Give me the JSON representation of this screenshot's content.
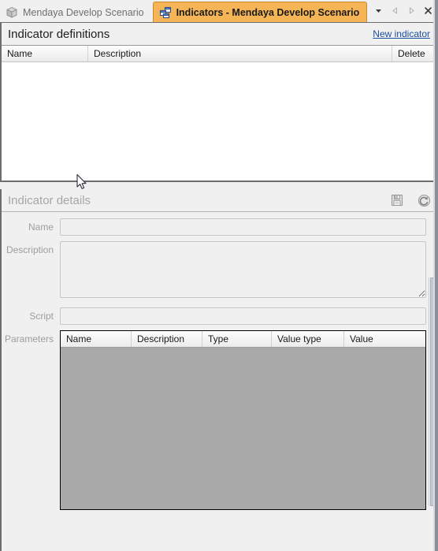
{
  "window": {
    "tabs": [
      {
        "label": "Mendaya Develop Scenario",
        "icon": "cube-icon",
        "active": false
      },
      {
        "label": "Indicators - Mendaya Develop Scenario",
        "icon": "stacked-windows-icon",
        "active": true
      }
    ],
    "controls": [
      {
        "name": "tab-menu-chevron",
        "glyph": "▼"
      },
      {
        "name": "scroll-tabs-left",
        "glyph": "◁"
      },
      {
        "name": "scroll-tabs-right",
        "glyph": "▷"
      },
      {
        "name": "close-view",
        "glyph": "✕"
      }
    ]
  },
  "definitions": {
    "title": "Indicator definitions",
    "new_link": "New indicator",
    "columns": [
      "Name",
      "Description",
      "Delete"
    ],
    "rows": []
  },
  "details": {
    "title": "Indicator details",
    "tools": [
      {
        "name": "save-icon",
        "label": "Save"
      },
      {
        "name": "revert-refresh-icon",
        "label": "Revert"
      }
    ],
    "fields": {
      "name": {
        "label": "Name",
        "value": "",
        "placeholder": ""
      },
      "description": {
        "label": "Description",
        "value": "",
        "placeholder": ""
      },
      "script": {
        "label": "Script",
        "value": "",
        "placeholder": ""
      }
    },
    "parameters": {
      "label": "Parameters",
      "columns": [
        "Name",
        "Description",
        "Type",
        "Value type",
        "Value"
      ],
      "rows": []
    }
  },
  "colors": {
    "active_tab": "#f5b556",
    "active_tab_border": "#c98a2e",
    "link": "#1b4fa0",
    "panel_bg": "#f0f0f0",
    "disabled_grid": "#a9a9a9",
    "muted_text": "#a6a6a6"
  }
}
